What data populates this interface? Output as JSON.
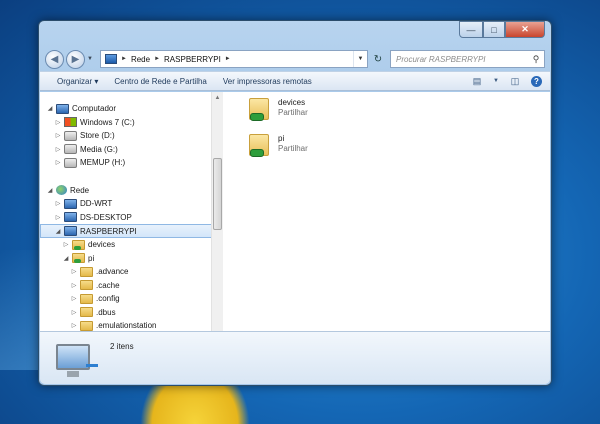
{
  "window": {
    "controls": {
      "minimize": "—",
      "maximize": "□",
      "close": "✕"
    }
  },
  "address_bar": {
    "crumbs": [
      "Rede",
      "RASPBERRYPI"
    ],
    "separator": "►",
    "search_placeholder": "Procurar RASPBERRYPI"
  },
  "toolbar": {
    "organize": "Organizar ▾",
    "network_center": "Centro de Rede e Partilha",
    "remote_printers": "Ver impressoras remotas"
  },
  "tree": {
    "computer": {
      "label": "Computador",
      "drives": [
        "Windows 7 (C:)",
        "Store (D:)",
        "Media (G:)",
        "MEMUP (H:)"
      ]
    },
    "network": {
      "label": "Rede",
      "hosts": [
        "DD-WRT",
        "DS-DESKTOP",
        "RASPBERRYPI"
      ],
      "shares": [
        "devices",
        "pi"
      ],
      "pi_folders": [
        ".advance",
        ".cache",
        ".config",
        ".dbus",
        ".emulationstation"
      ]
    }
  },
  "files": [
    {
      "name": "devices",
      "type": "Partilhar"
    },
    {
      "name": "pi",
      "type": "Partilhar"
    }
  ],
  "details": {
    "item_count": "2 itens"
  },
  "colors": {
    "accent": "#2a69b8",
    "selection": "#d3e6f9",
    "desktop": "#1466b4"
  }
}
